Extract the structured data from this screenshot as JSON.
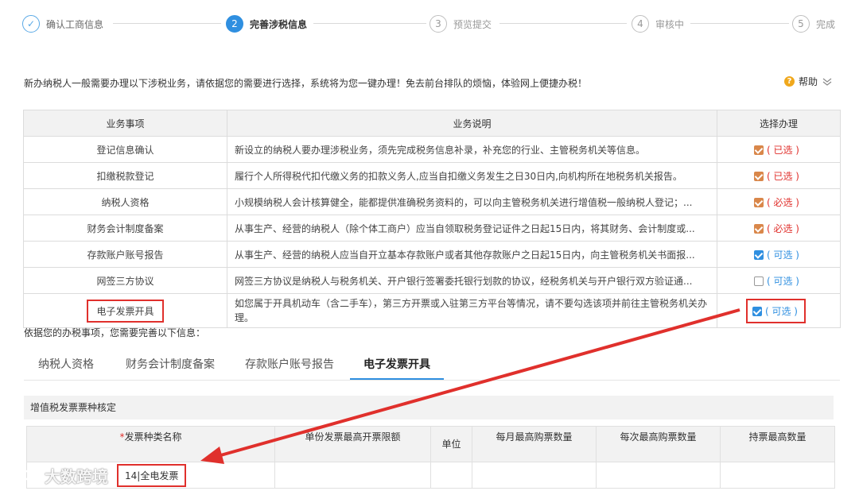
{
  "steps": [
    {
      "num": "✓",
      "label": "确认工商信息",
      "state": "done"
    },
    {
      "num": "2",
      "label": "完善涉税信息",
      "state": "active"
    },
    {
      "num": "3",
      "label": "预览提交",
      "state": "todo"
    },
    {
      "num": "4",
      "label": "审核中",
      "state": "todo"
    },
    {
      "num": "5",
      "label": "完成",
      "state": "todo"
    }
  ],
  "intro_text": "新办纳税人一般需要办理以下涉税业务，请依据您的需要进行选择，系统将为您一键办理！免去前台排队的烦恼，体验网上便捷办税！",
  "help": {
    "icon": "question-icon",
    "label": "帮助"
  },
  "table": {
    "headers": [
      "业务事项",
      "业务说明",
      "选择办理"
    ],
    "rows": [
      {
        "item": "登记信息确认",
        "desc": "新设立的纳税人要办理涉税业务，须先完成税务信息补录，补充您的行业、主管税务机关等信息。",
        "check": "orange",
        "label": "( 已选 )",
        "label_color": "red"
      },
      {
        "item": "扣缴税款登记",
        "desc": "履行个人所得税代扣代缴义务的扣款义务人,应当自扣缴义务发生之日30日内,向机构所在地税务机关报告。",
        "check": "orange",
        "label": "( 已选 )",
        "label_color": "red"
      },
      {
        "item": "纳税人资格",
        "desc": "小规模纳税人会计核算健全，能都提供准确税务资料的，可以向主管税务机关进行增值税一般纳税人登记；...",
        "check": "orange",
        "label": "( 必选 )",
        "label_color": "red"
      },
      {
        "item": "财务会计制度备案",
        "desc": "从事生产、经营的纳税人（除个体工商户）应当自领取税务登记证件之日起15日内，将其财务、会计制度或...",
        "check": "orange",
        "label": "( 必选 )",
        "label_color": "red"
      },
      {
        "item": "存款账户账号报告",
        "desc": "从事生产、经营的纳税人应当自开立基本存款账户或者其他存款账户之日起15日内，向主管税务机关书面报...",
        "check": "blue",
        "label": "( 可选 )",
        "label_color": "blue"
      },
      {
        "item": "网签三方协议",
        "desc": "网签三方协议是纳税人与税务机关、开户银行签署委托银行划款的协议，经税务机关与开户银行双方验证通...",
        "check": "empty",
        "label": "( 可选 )",
        "label_color": "blue"
      },
      {
        "item": "电子发票开具",
        "desc": "如您属于开具机动车（含二手车），第三方开票或入驻第三方平台等情况，请不要勾选该项并前往主管税务机关办理。",
        "check": "blue",
        "label": "( 可选 )",
        "label_color": "blue"
      }
    ]
  },
  "info_text": "依据您的办税事项，您需要完善以下信息：",
  "tabs": [
    "纳税人资格",
    "财务会计制度备案",
    "存款账户账号报告",
    "电子发票开具"
  ],
  "active_tab": "电子发票开具",
  "invoice": {
    "section_title": "增值税发票票种核定",
    "required_mark": "*",
    "headers": [
      "发票种类名称",
      "单份发票最高开票限额",
      "单位",
      "每月最高购票数量",
      "每次最高购票数量",
      "持票最高数量"
    ],
    "row_value": "14|全电发票"
  },
  "watermark": "大数跨境",
  "colors": {
    "accent": "#2f8fe0",
    "red": "#e0302c",
    "orange": "#d9874a"
  }
}
